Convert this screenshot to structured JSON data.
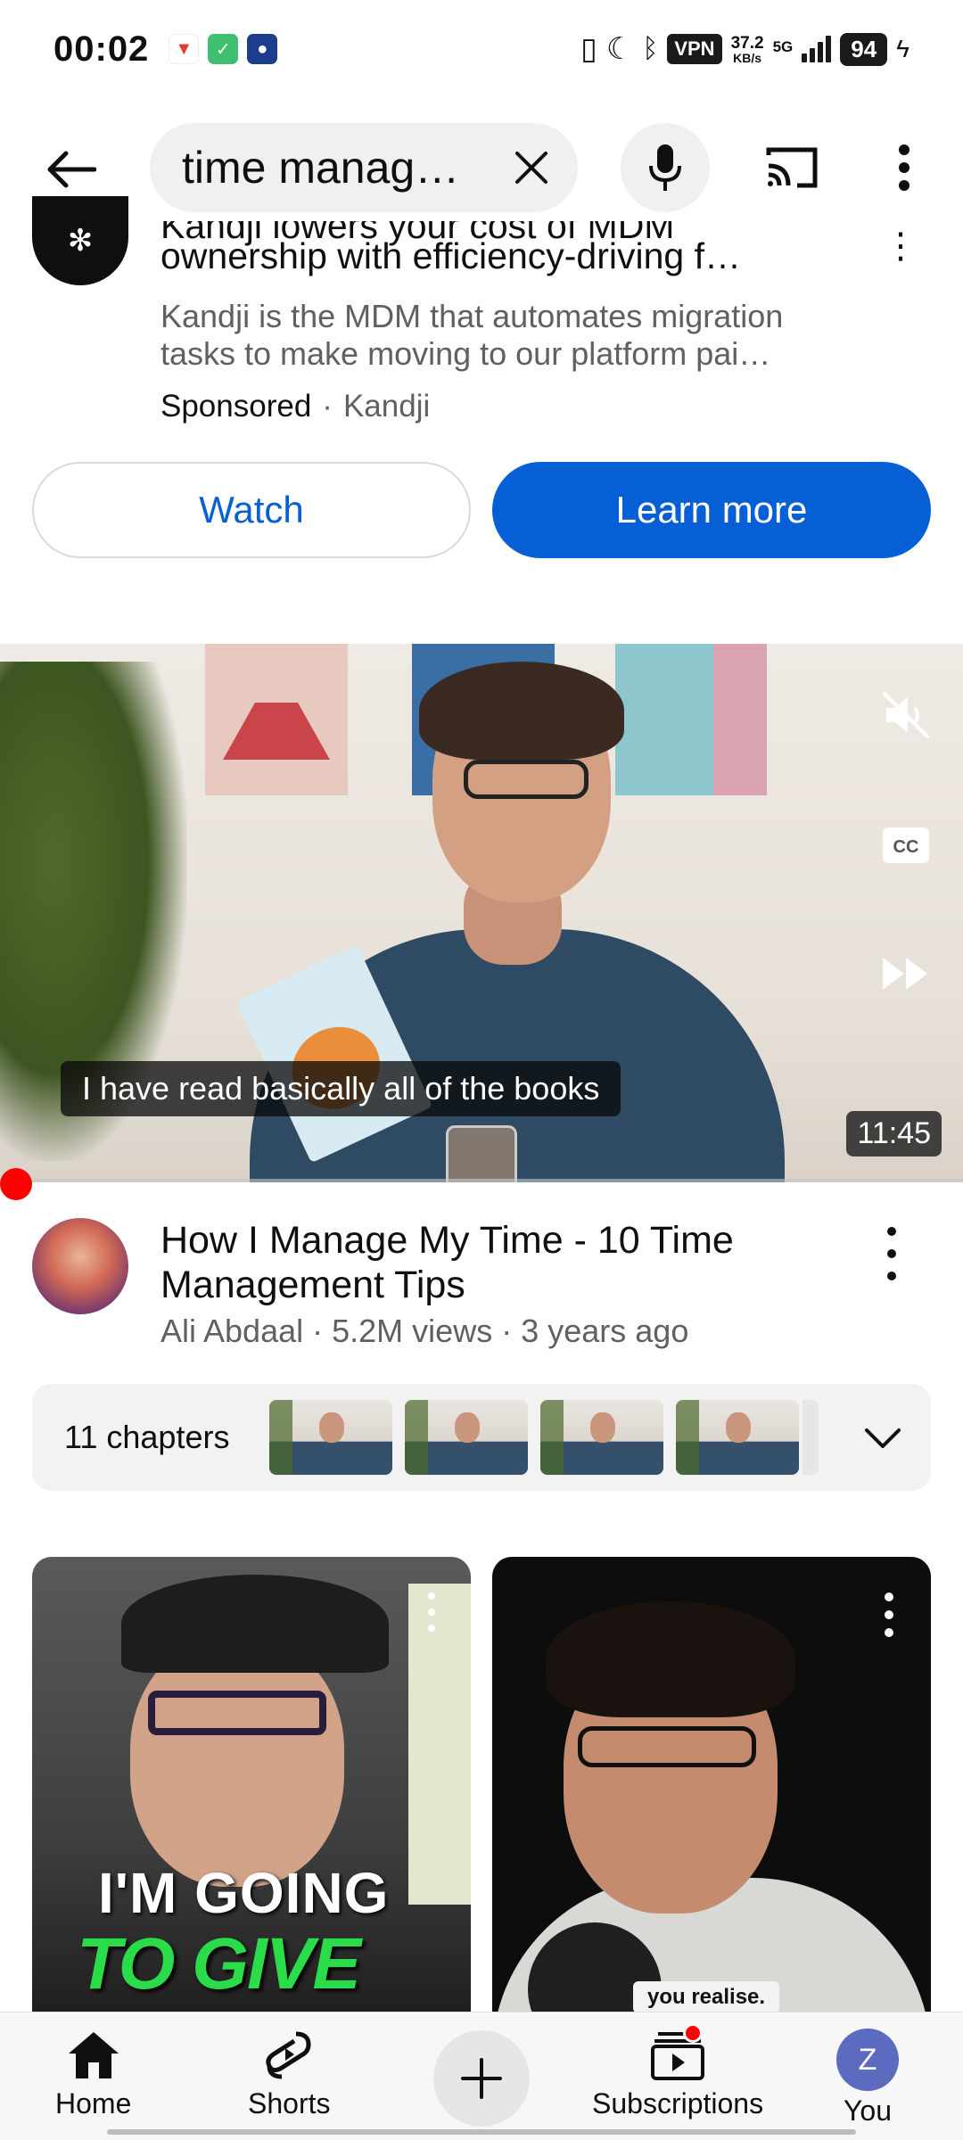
{
  "status_bar": {
    "time": "00:02",
    "vpn": "VPN",
    "speed_value": "37.2",
    "speed_unit": "KB/s",
    "network": "5G",
    "battery": "94"
  },
  "search": {
    "query": "time manag…"
  },
  "ad": {
    "title_partial": "Kandji lowers your cost of MDM",
    "title": "ownership with efficiency-driving f…",
    "description_line1": "Kandji is the MDM that automates migration",
    "description_line2": "tasks to make moving to our platform pai…",
    "sponsored_label": "Sponsored",
    "advertiser": "Kandji",
    "watch_label": "Watch",
    "learn_more_label": "Learn more"
  },
  "player": {
    "caption": "I have read basically all of the books",
    "duration": "11:45"
  },
  "video": {
    "title": "How I Manage My Time - 10 Time Management Tips",
    "channel": "Ali Abdaal",
    "views": "5.2M views",
    "age": "3 years ago"
  },
  "chapters": {
    "label": "11 chapters"
  },
  "shorts": {
    "short1_text_line1": "I'M GOING",
    "short1_text_line2": "TO GIVE YOU",
    "short2_caption": "you realise."
  },
  "nav": {
    "home": "Home",
    "shorts": "Shorts",
    "subscriptions": "Subscriptions",
    "you": "You",
    "you_initial": "Z"
  },
  "colors": {
    "accent_blue": "#065fd4",
    "progress_red": "#ff0000",
    "avatar_purple": "#5c6bc0"
  }
}
